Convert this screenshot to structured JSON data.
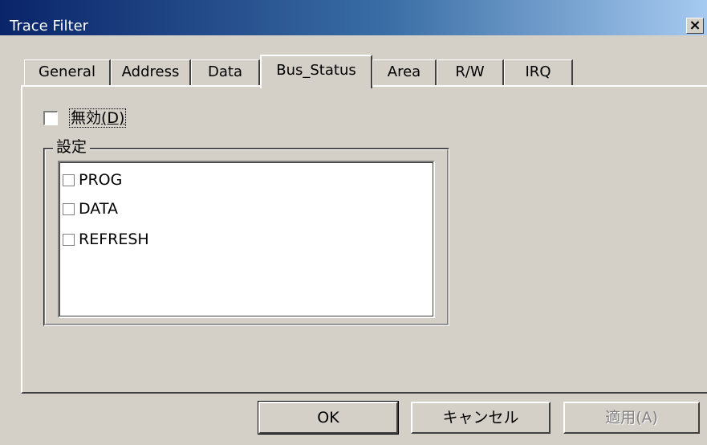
{
  "window": {
    "title": "Trace Filter",
    "close_label": "×"
  },
  "tabs": [
    {
      "label": "General",
      "active": false
    },
    {
      "label": "Address",
      "active": false
    },
    {
      "label": "Data",
      "active": false
    },
    {
      "label": "Bus_Status",
      "active": true
    },
    {
      "label": "Area",
      "active": false
    },
    {
      "label": "R/W",
      "active": false
    },
    {
      "label": "IRQ",
      "active": false
    }
  ],
  "disable_checkbox": {
    "label_main": "無効",
    "label_accel": "(D)",
    "checked": false
  },
  "settings_group": {
    "legend": "設定",
    "items": [
      {
        "label": "PROG",
        "checked": false
      },
      {
        "label": "DATA",
        "checked": false
      },
      {
        "label": "REFRESH",
        "checked": false
      }
    ]
  },
  "buttons": {
    "ok": "OK",
    "cancel": "キャンセル",
    "apply": "適用(A)"
  }
}
